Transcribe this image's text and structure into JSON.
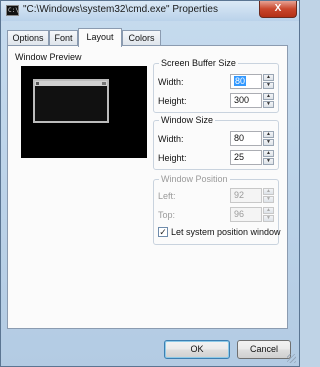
{
  "window": {
    "title": "\"C:\\Windows\\system32\\cmd.exe\" Properties",
    "close_glyph": "X",
    "icon": "cmd-console-icon",
    "icon_text": "C:\\"
  },
  "tabs": [
    {
      "label": "Options",
      "active": false
    },
    {
      "label": "Font",
      "active": false
    },
    {
      "label": "Layout",
      "active": true
    },
    {
      "label": "Colors",
      "active": false
    }
  ],
  "preview": {
    "label": "Window Preview"
  },
  "screen_buffer": {
    "title": "Screen Buffer Size",
    "width_label": "Width:",
    "width_value": "80",
    "height_label": "Height:",
    "height_value": "300"
  },
  "window_size": {
    "title": "Window Size",
    "width_label": "Width:",
    "width_value": "80",
    "height_label": "Height:",
    "height_value": "25"
  },
  "window_position": {
    "title": "Window Position",
    "left_label": "Left:",
    "left_value": "92",
    "top_label": "Top:",
    "top_value": "96",
    "let_system_label": "Let system position window",
    "let_system_checked": true
  },
  "buttons": {
    "ok": "OK",
    "cancel": "Cancel"
  },
  "colors": {
    "accent": "#3399ff",
    "titlebar": "#c6dbee",
    "close": "#c9462c"
  }
}
